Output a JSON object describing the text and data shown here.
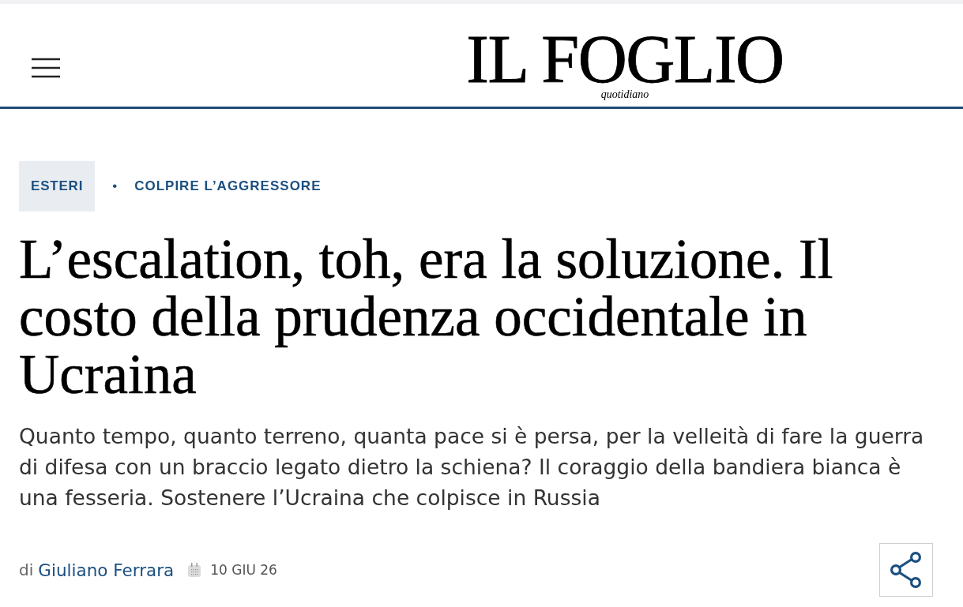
{
  "header": {
    "logo": {
      "name": "IL FOGLIO",
      "tagline": "quotidiano"
    }
  },
  "breadcrumb": {
    "section": "ESTERI",
    "separator": "•",
    "topic": "COLPIRE L’AGGRESSORE"
  },
  "article": {
    "headline": "L’escalation, toh, era la soluzione. Il costo della prudenza occidentale in Ucraina",
    "summary": "Quanto tempo, quanto terreno, quanta pace si è persa, per la velleità di fare la guerra di difesa con un braccio legato dietro la schiena? Il coraggio della bandiera bianca è una fesseria. Sostenere l’Ucraina che colpisce in Russia",
    "byline": {
      "prefix": "di",
      "author": "Giuliano Ferrara",
      "date": "10 GIU 26"
    }
  }
}
